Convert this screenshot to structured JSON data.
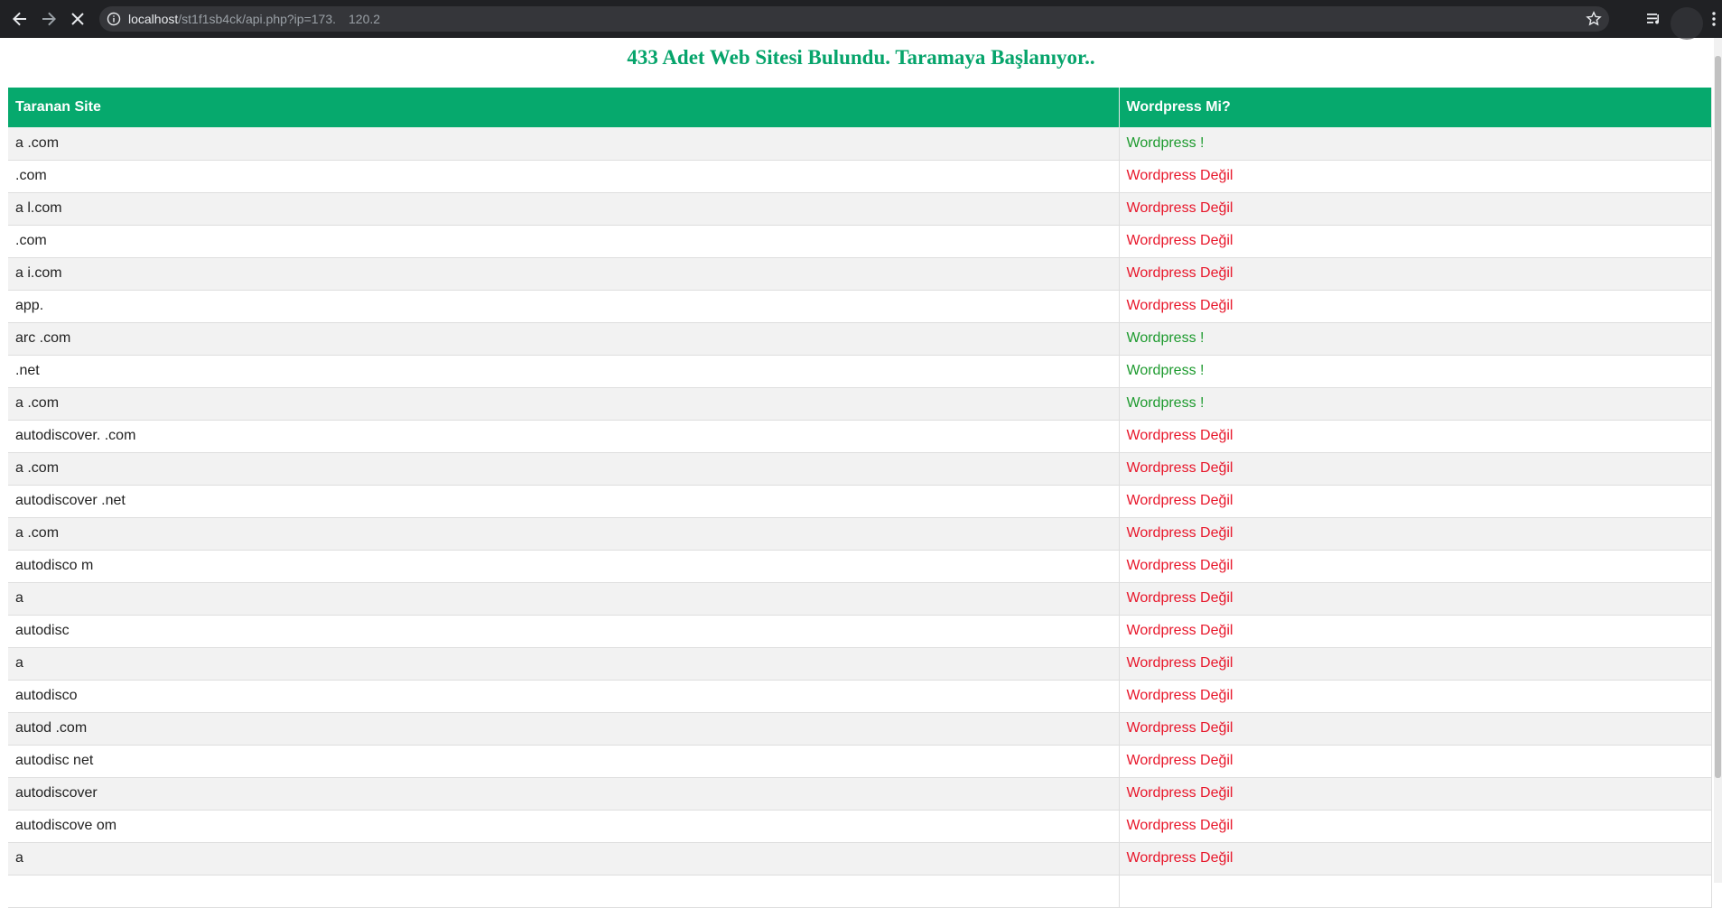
{
  "browser": {
    "url_host": "localhost",
    "url_path": "/st1f1sb4ck/api.php?ip=173.",
    "url_tail": "120.2"
  },
  "page": {
    "title": "433 Adet Web Sitesi Bulundu. Taramaya Başlanıyor.."
  },
  "table": {
    "headers": [
      "Taranan Site",
      "Wordpress Mi?"
    ],
    "rows": [
      {
        "site": "a           .com",
        "status": "Wordpress !",
        "wp": true
      },
      {
        "site": "             .com",
        "status": "Wordpress Değil",
        "wp": false
      },
      {
        "site": "a         l.com",
        "status": "Wordpress Değil",
        "wp": false
      },
      {
        "site": "            .com",
        "status": "Wordpress Değil",
        "wp": false
      },
      {
        "site": "a                  i.com",
        "status": "Wordpress Değil",
        "wp": false
      },
      {
        "site": "app.",
        "status": "Wordpress Değil",
        "wp": false
      },
      {
        "site": "arc                          .com",
        "status": "Wordpress !",
        "wp": true
      },
      {
        "site": "      .net",
        "status": "Wordpress !",
        "wp": true
      },
      {
        "site": "a                     .com",
        "status": "Wordpress !",
        "wp": true
      },
      {
        "site": "autodiscover.             .com",
        "status": "Wordpress Değil",
        "wp": false
      },
      {
        "site": "a                          .com",
        "status": "Wordpress Değil",
        "wp": false
      },
      {
        "site": "autodiscover          .net",
        "status": "Wordpress Değil",
        "wp": false
      },
      {
        "site": "a                                .com",
        "status": "Wordpress Değil",
        "wp": false
      },
      {
        "site": "autodisco                     m",
        "status": "Wordpress Değil",
        "wp": false
      },
      {
        "site": "a",
        "status": "Wordpress Değil",
        "wp": false
      },
      {
        "site": "autodisc",
        "status": "Wordpress Değil",
        "wp": false
      },
      {
        "site": "a",
        "status": "Wordpress Değil",
        "wp": false
      },
      {
        "site": "autodisco",
        "status": "Wordpress Değil",
        "wp": false
      },
      {
        "site": "autod                   .com",
        "status": "Wordpress Değil",
        "wp": false
      },
      {
        "site": "autodisc               net",
        "status": "Wordpress Değil",
        "wp": false
      },
      {
        "site": "autodiscover",
        "status": "Wordpress Değil",
        "wp": false
      },
      {
        "site": "autodiscove             om",
        "status": "Wordpress Değil",
        "wp": false
      },
      {
        "site": "a",
        "status": "Wordpress Değil",
        "wp": false
      },
      {
        "site": "",
        "status": "",
        "wp": false
      }
    ]
  },
  "colors": {
    "title_green": "#06a46b",
    "header_green": "#06a96d",
    "wp_yes": "#1d9a2e",
    "wp_no": "#e8162a"
  },
  "icons": [
    "back-arrow-icon",
    "forward-arrow-icon",
    "stop-icon",
    "info-icon",
    "star-icon",
    "queue-icon",
    "menu-dots-icon"
  ]
}
